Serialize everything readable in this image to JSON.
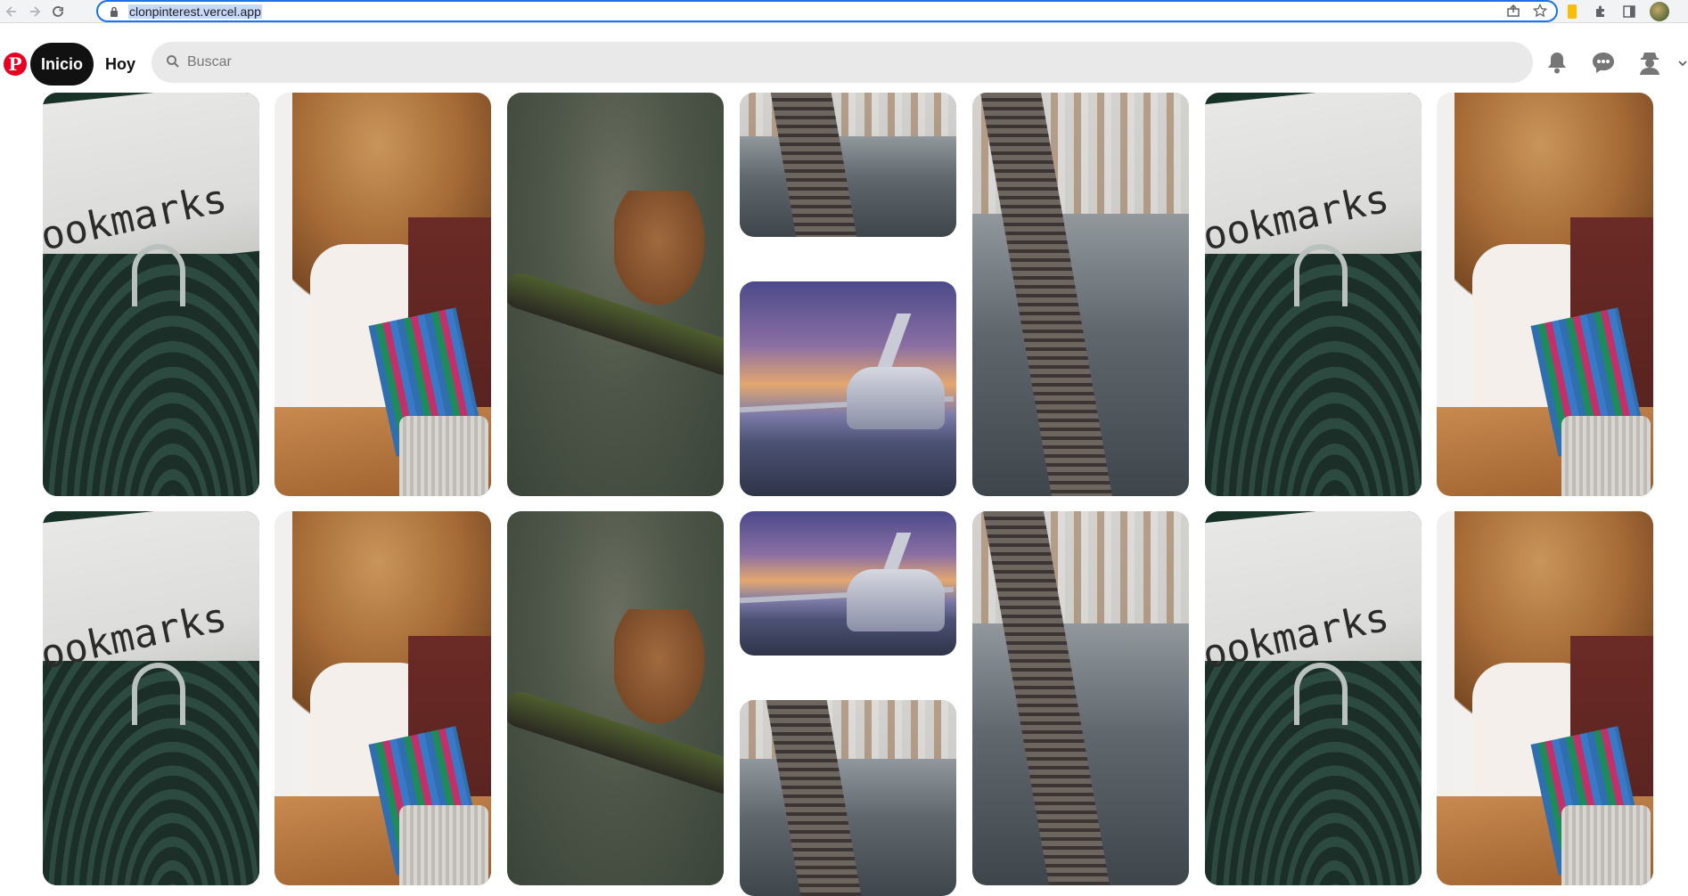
{
  "browser": {
    "url": "clonpinterest.vercel.app"
  },
  "header": {
    "logo": "P",
    "home_label": "Inicio",
    "today_label": "Hoy",
    "search_placeholder": "Buscar"
  },
  "pins": {
    "typewriter_text": "ookmarks"
  },
  "colors": {
    "brand": "#e60023",
    "active_nav": "#111111",
    "search_bg": "#e9e9e9",
    "focus_ring": "#1a73e8"
  },
  "icons": [
    "back-icon",
    "forward-icon",
    "reload-icon",
    "lock-icon",
    "share-icon",
    "star-icon",
    "extension-icon",
    "puzzle-icon",
    "sidebar-icon",
    "profile-avatar",
    "search-icon",
    "bell-icon",
    "chat-icon",
    "user-icon",
    "chevron-down-icon"
  ]
}
